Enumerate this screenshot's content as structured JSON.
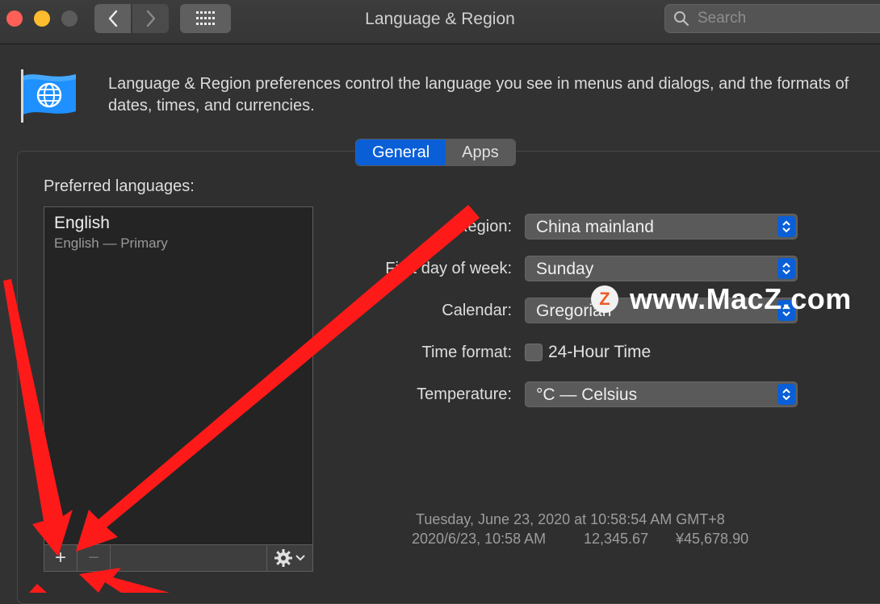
{
  "window": {
    "title": "Language & Region",
    "search_placeholder": "Search"
  },
  "header": {
    "description": "Language & Region preferences control the language you see in menus and dialogs, and the formats of dates, times, and currencies."
  },
  "tabs": [
    {
      "label": "General",
      "selected": true
    },
    {
      "label": "Apps",
      "selected": false
    }
  ],
  "languages": {
    "heading": "Preferred languages:",
    "items": [
      {
        "name": "English",
        "subtitle": "English — Primary"
      }
    ],
    "add_symbol": "+",
    "remove_symbol": "−"
  },
  "settings": {
    "region": {
      "label": "Region:",
      "value": "China mainland"
    },
    "first_day": {
      "label": "First day of week:",
      "value": "Sunday"
    },
    "calendar": {
      "label": "Calendar:",
      "value": "Gregorian"
    },
    "time_format": {
      "label": "Time format:",
      "option": "24-Hour Time",
      "checked": false
    },
    "temperature": {
      "label": "Temperature:",
      "value": "°C — Celsius"
    }
  },
  "samples": {
    "line1": "Tuesday, June 23, 2020 at 10:58:54 AM GMT+8",
    "date_short": "2020/6/23, 10:58 AM",
    "number": "12,345.67",
    "currency": "¥45,678.90"
  },
  "watermark": {
    "logo_letter": "Z",
    "text": "www.MacZ.com"
  },
  "colors": {
    "accent": "#0a5fd7",
    "annotation": "#ff1a1a"
  }
}
